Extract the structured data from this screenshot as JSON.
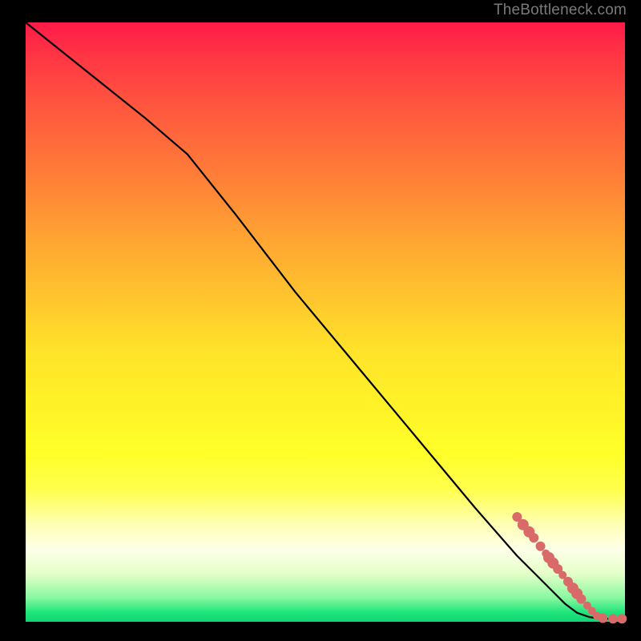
{
  "attribution": "TheBottleneck.com",
  "colors": {
    "line": "#000000",
    "marker": "#d96a6a",
    "bg_top": "#ff1a49",
    "bg_bottom": "#13d474"
  },
  "chart_data": {
    "type": "line",
    "title": "",
    "xlabel": "",
    "ylabel": "",
    "xlim": [
      0,
      100
    ],
    "ylim": [
      0,
      100
    ],
    "series": [
      {
        "name": "curve",
        "x": [
          0,
          10,
          20,
          27,
          35,
          45,
          55,
          65,
          75,
          82,
          86,
          88,
          90,
          92,
          94,
          96,
          98,
          100
        ],
        "y": [
          100,
          92,
          84,
          78,
          68,
          55,
          43,
          31,
          19,
          11,
          7,
          5,
          3,
          1.5,
          0.8,
          0.5,
          0.5,
          0.5
        ]
      }
    ],
    "markers": {
      "name": "highlight",
      "points": [
        {
          "x": 82.0,
          "y": 17.5,
          "r": 6
        },
        {
          "x": 83.0,
          "y": 16.2,
          "r": 7
        },
        {
          "x": 84.0,
          "y": 15.0,
          "r": 7
        },
        {
          "x": 84.8,
          "y": 14.0,
          "r": 6
        },
        {
          "x": 85.9,
          "y": 12.6,
          "r": 6
        },
        {
          "x": 86.8,
          "y": 11.4,
          "r": 5
        },
        {
          "x": 87.3,
          "y": 10.7,
          "r": 7
        },
        {
          "x": 88.0,
          "y": 9.8,
          "r": 7
        },
        {
          "x": 88.8,
          "y": 8.8,
          "r": 6
        },
        {
          "x": 89.6,
          "y": 7.8,
          "r": 5
        },
        {
          "x": 90.5,
          "y": 6.7,
          "r": 6
        },
        {
          "x": 91.3,
          "y": 5.6,
          "r": 7
        },
        {
          "x": 92.0,
          "y": 4.7,
          "r": 7
        },
        {
          "x": 92.7,
          "y": 3.8,
          "r": 6
        },
        {
          "x": 93.7,
          "y": 2.7,
          "r": 5
        },
        {
          "x": 94.5,
          "y": 1.8,
          "r": 5
        },
        {
          "x": 95.3,
          "y": 1.0,
          "r": 5
        },
        {
          "x": 96.3,
          "y": 0.6,
          "r": 6
        },
        {
          "x": 98.0,
          "y": 0.5,
          "r": 6
        },
        {
          "x": 99.5,
          "y": 0.5,
          "r": 6
        }
      ]
    }
  }
}
